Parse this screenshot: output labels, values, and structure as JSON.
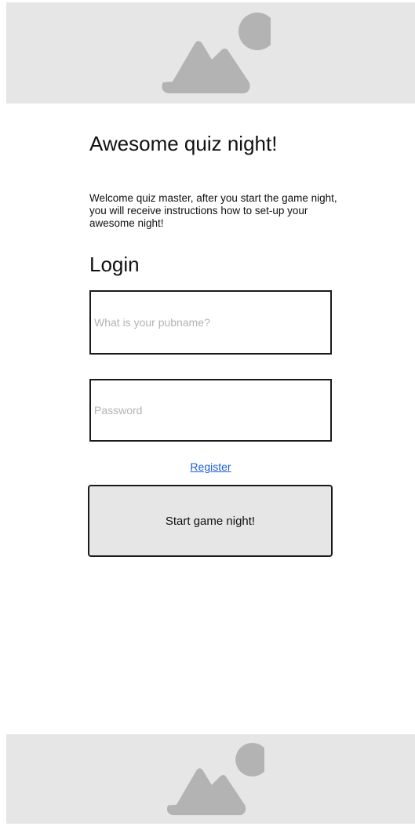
{
  "header_banner": {
    "icon": "image-placeholder-icon"
  },
  "content": {
    "title": "Awesome quiz night!",
    "intro": "Welcome quiz master, after you start the game night, you will receive instructions how to set-up your awesome night!",
    "login_heading": "Login"
  },
  "form": {
    "pubname": {
      "value": "",
      "placeholder": "What is your pubname?"
    },
    "password": {
      "value": "",
      "placeholder": "Password"
    },
    "register_label": "Register",
    "start_label": "Start game night!"
  },
  "footer_banner": {
    "icon": "image-placeholder-icon"
  },
  "colors": {
    "banner_background": "#e6e6e6",
    "placeholder_shape": "#b3b3b3",
    "link": "#1a5fd6",
    "button_background": "#e6e6e6",
    "border": "#1a1a1a"
  }
}
